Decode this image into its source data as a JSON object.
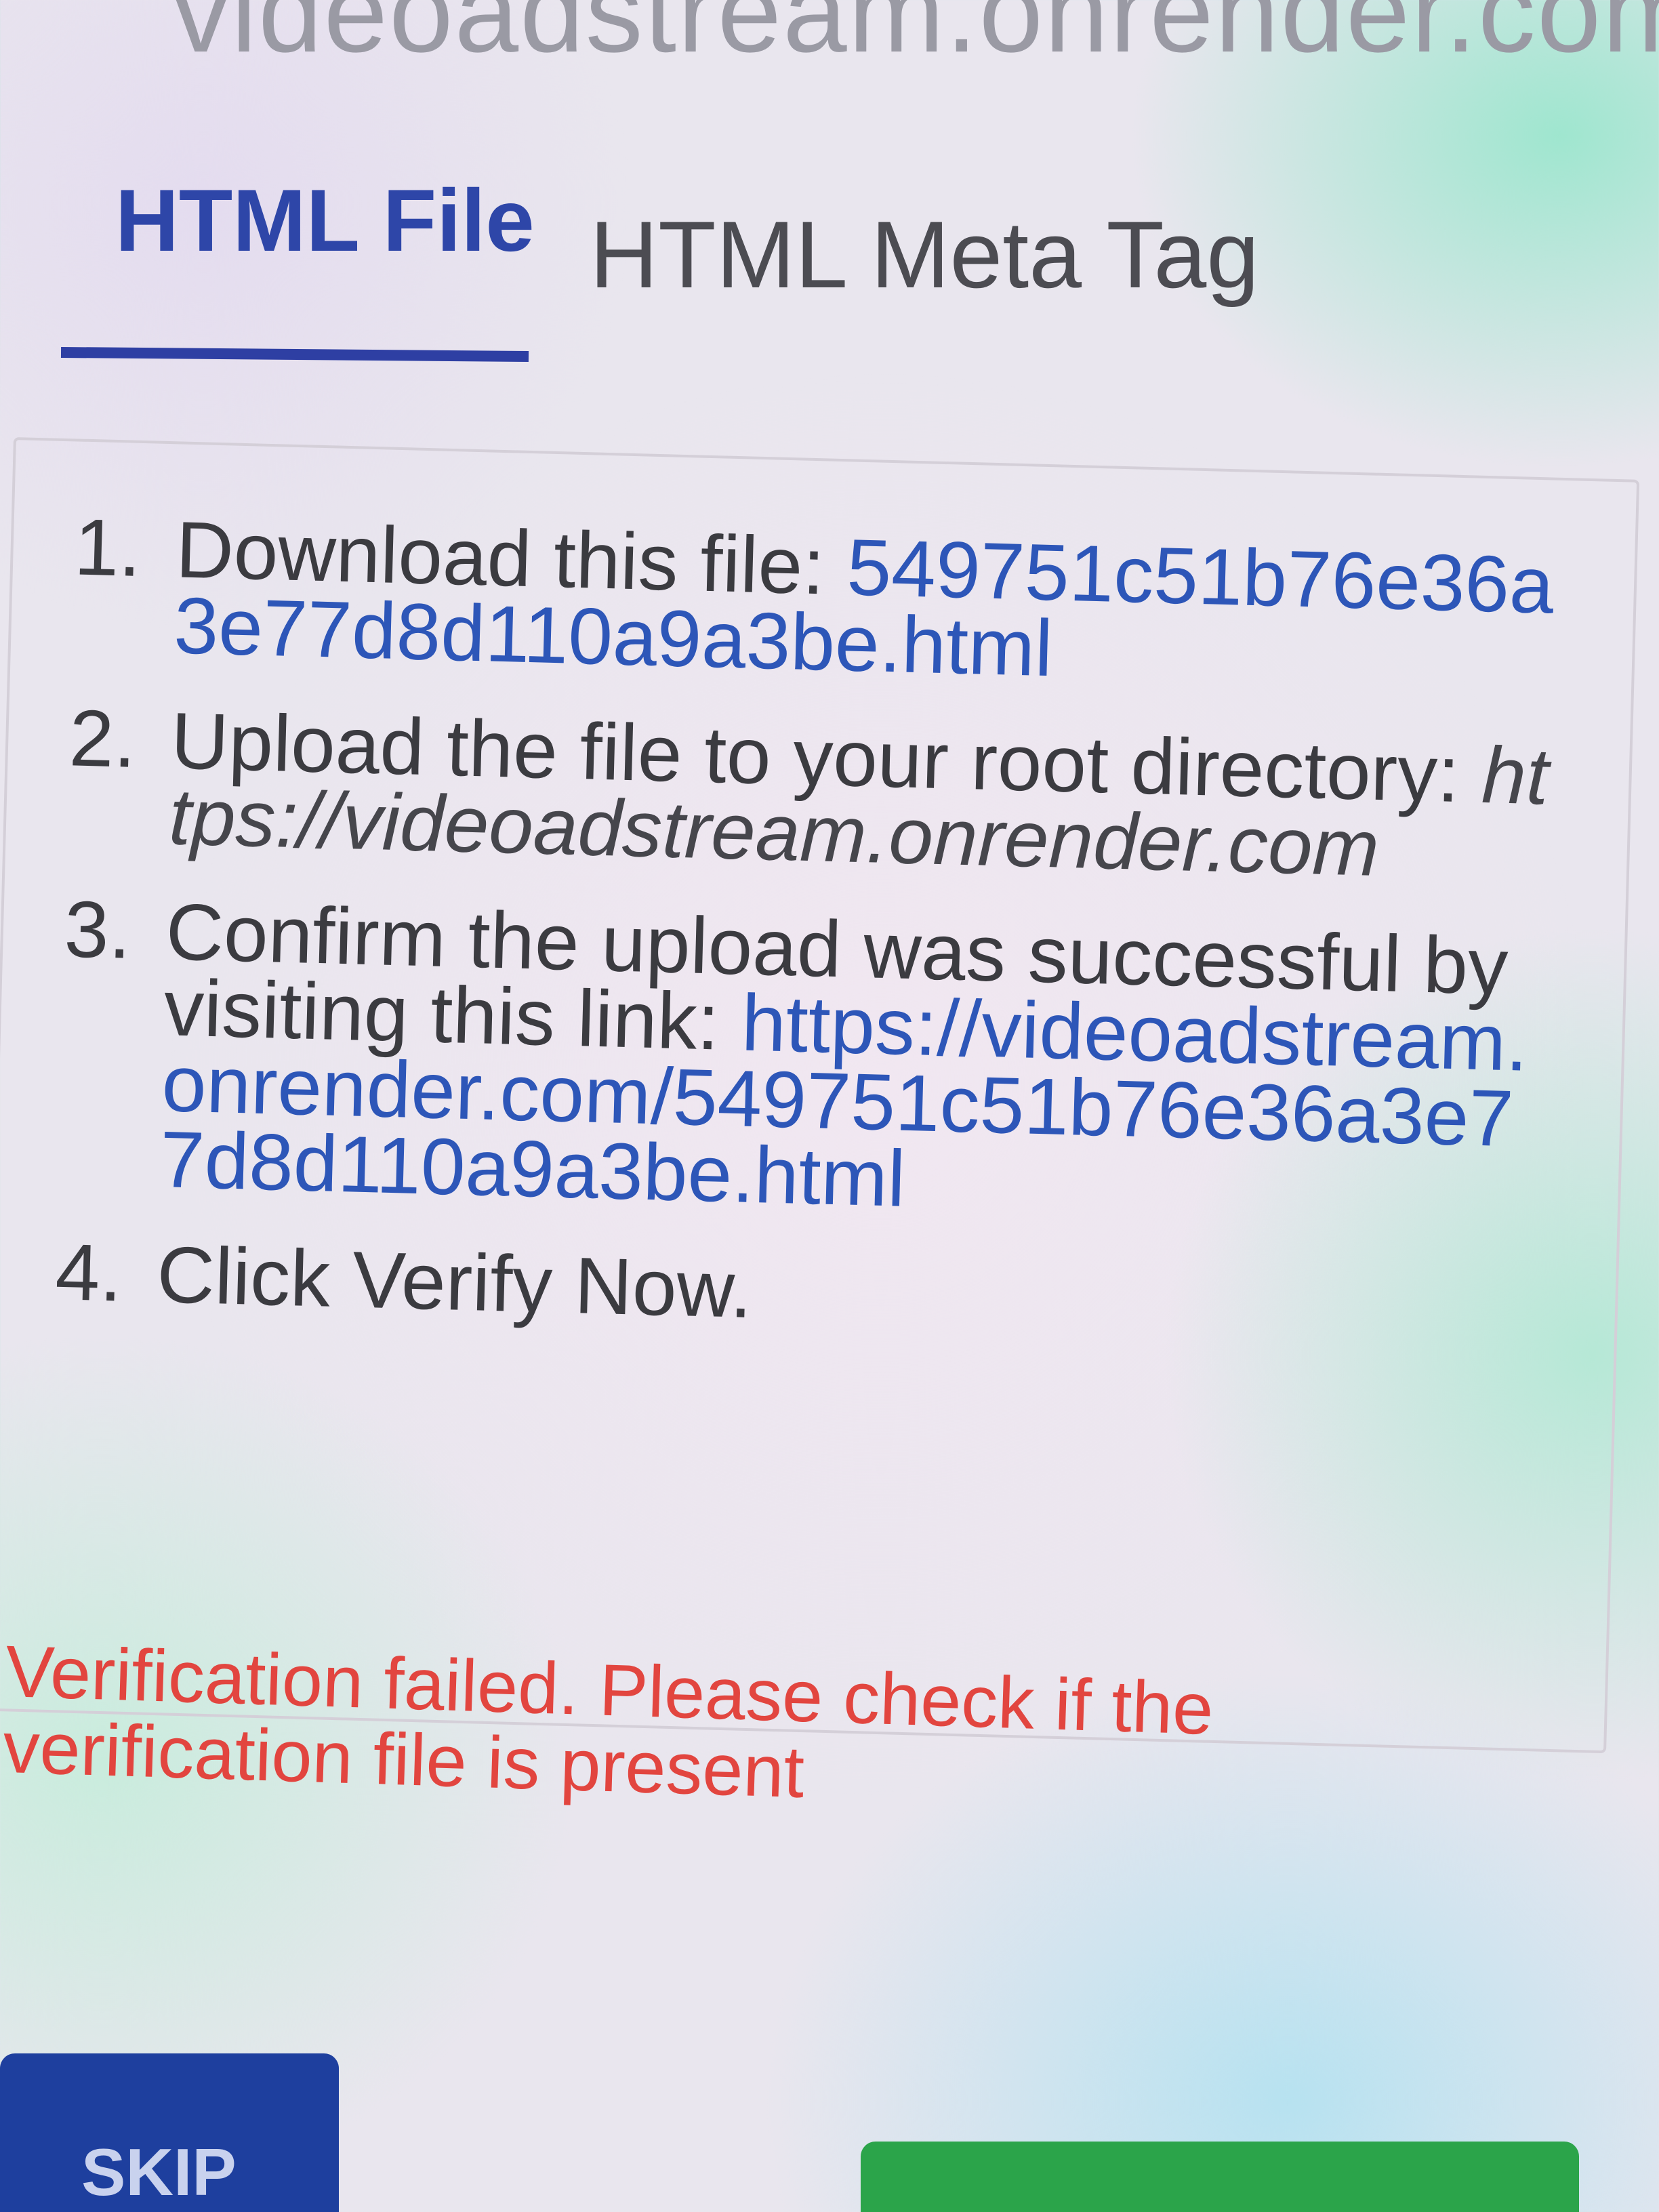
{
  "header": {
    "site_url": "videoadstream.onrender.com"
  },
  "tabs": [
    {
      "label": "HTML File",
      "active": true
    },
    {
      "label": "HTML Meta Tag",
      "active": false
    }
  ],
  "steps": [
    {
      "number": "1.",
      "text": "Download this file: ",
      "link": "549751c51b76e36a3e77d8d110a9a3be.html"
    },
    {
      "number": "2.",
      "text": "Upload the file to your root directory: ",
      "url": "https://videoadstream.onrender.com"
    },
    {
      "number": "3.",
      "text": "Confirm the upload was successful by visiting this link: ",
      "link": "https://videoadstream.onrender.com/549751c51b76e36a3e77d8d110a9a3be.html"
    },
    {
      "number": "4.",
      "text": "Click Verify Now."
    }
  ],
  "error": {
    "message": "Verification failed. Please check if the verification file is present"
  },
  "buttons": {
    "skip_label": "SKIP",
    "verify_label": ""
  },
  "colors": {
    "accent": "#2e46a8",
    "link": "#2d56b8",
    "error": "#e2453f",
    "skip_button": "#1e3f9e",
    "verify_button": "#2ba44a"
  }
}
